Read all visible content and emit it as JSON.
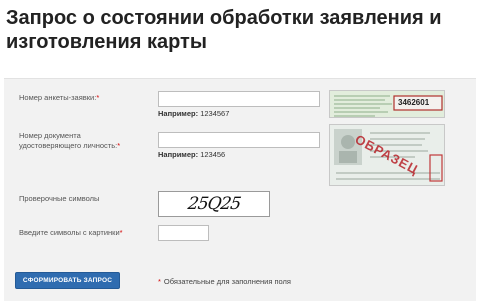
{
  "page": {
    "title": "Запрос о состоянии обработки заявления и изготовления карты"
  },
  "form": {
    "application_number": {
      "label": "Номер анкеты-заявки:",
      "required_mark": "*",
      "value": "",
      "example_prefix": "Например:",
      "example_value": "1234567"
    },
    "document_number": {
      "label_line1": "Номер документа",
      "label_line2": "удостоверяющего личность:",
      "required_mark": "*",
      "value": "",
      "example_prefix": "Например:",
      "example_value": "123456"
    },
    "captcha": {
      "label": "Проверочные символы",
      "text": "25Q25"
    },
    "captcha_input": {
      "label": "Введите символы с картинки",
      "required_mark": "*",
      "value": ""
    },
    "submit_label": "СФОРМИРОВАТЬ ЗАПРОС",
    "required_note_mark": "*",
    "required_note": "Обязательные для заполнения поля"
  },
  "samples": {
    "application_sample_number": "3462601",
    "document_sample_stamp": "ОБРАЗЕЦ"
  },
  "colors": {
    "button_bg": "#2f6cb0",
    "required": "#d40000",
    "panel_bg": "#f2f2f2"
  }
}
